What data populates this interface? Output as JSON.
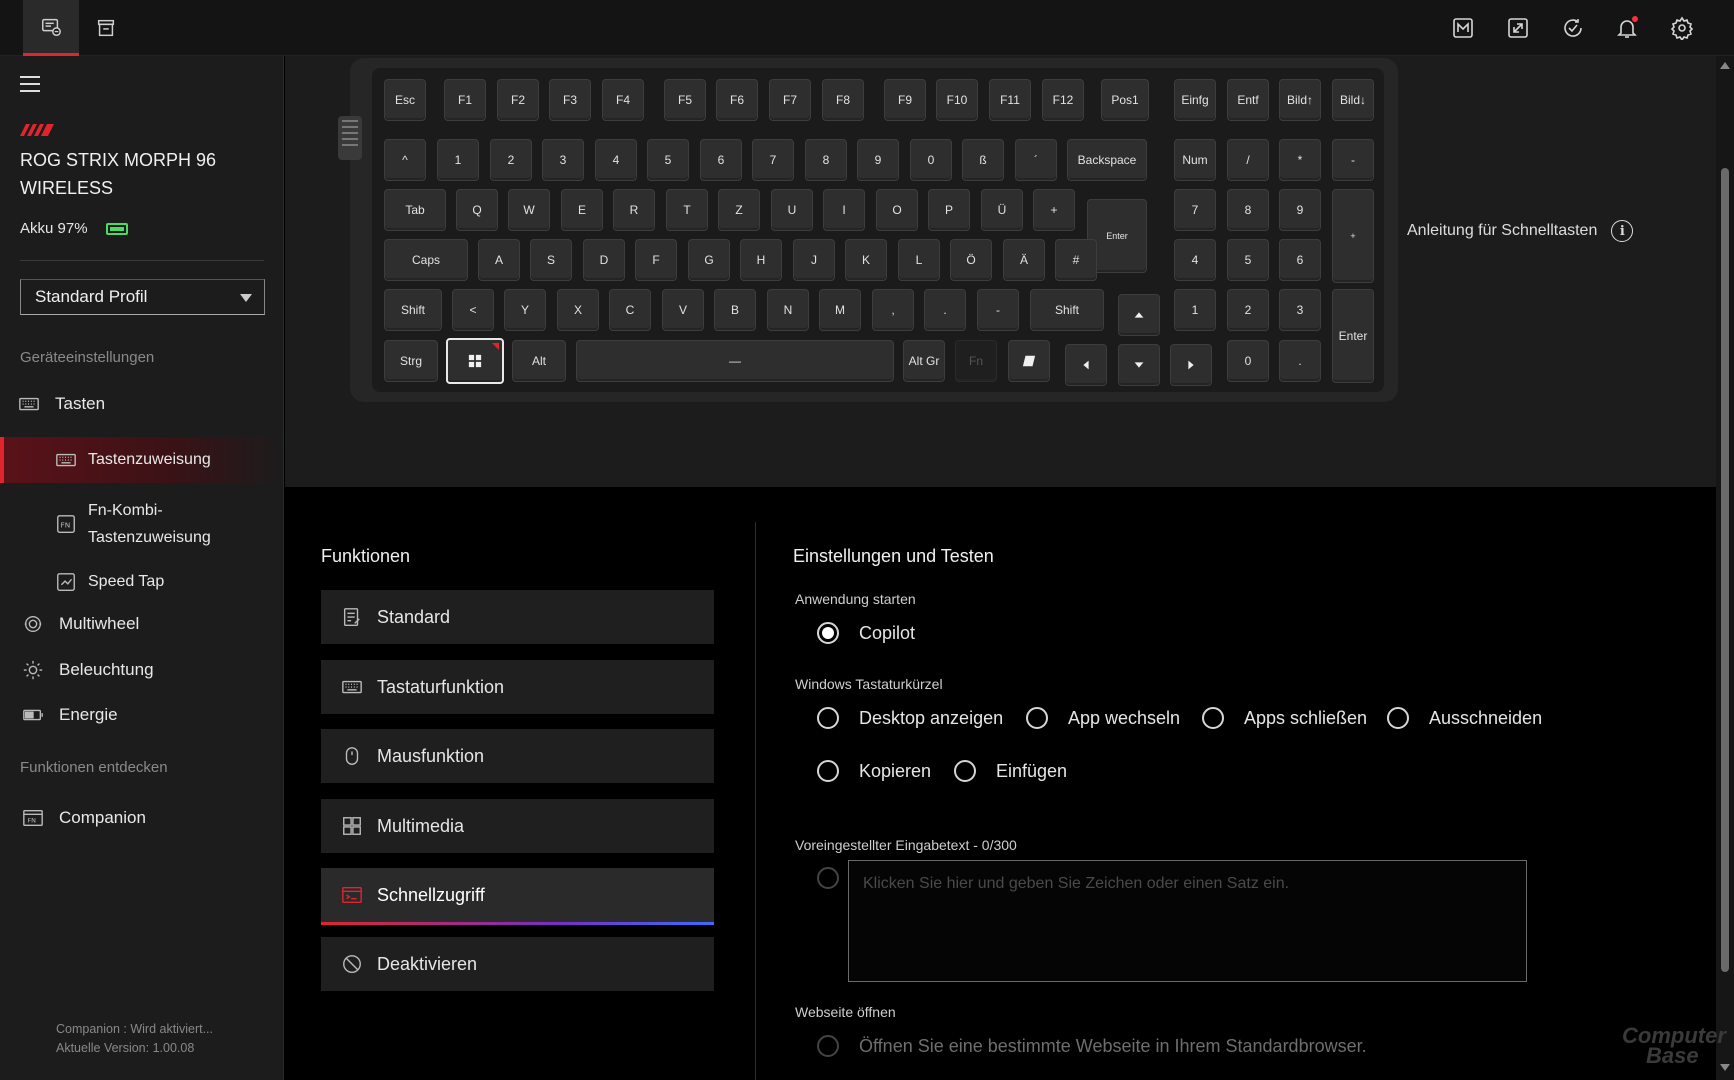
{
  "topbar": {
    "left_icons": [
      "device-icon",
      "store-icon"
    ],
    "right_icons": [
      "macro-icon",
      "resize-icon",
      "update-check-icon",
      "bell-icon",
      "gear-icon"
    ]
  },
  "sidebar": {
    "device_name": "ROG STRIX MORPH 96 WIRELESS",
    "battery_label": "Akku 97%",
    "profile": "Standard Profil",
    "section_device": "Geräteeinstellungen",
    "section_discover": "Funktionen entdecken",
    "items": {
      "tasten": "Tasten",
      "tastenzuweisung": "Tastenzuweisung",
      "fn_kombi_1": "Fn-Kombi-",
      "fn_kombi_2": "Tastenzuweisung",
      "speed_tap": "Speed Tap",
      "multiwheel": "Multiwheel",
      "beleuchtung": "Beleuchtung",
      "energie": "Energie",
      "companion": "Companion"
    },
    "footer_status": "Companion : Wird aktiviert...",
    "footer_version": "Aktuelle Version: 1.00.08"
  },
  "keyboard": {
    "keys": {
      "esc": "Esc",
      "f1": "F1",
      "f2": "F2",
      "f3": "F3",
      "f4": "F4",
      "f5": "F5",
      "f6": "F6",
      "f7": "F7",
      "f8": "F8",
      "f9": "F9",
      "f10": "F10",
      "f11": "F11",
      "f12": "F12",
      "pos1": "Pos1",
      "einfg": "Einfg",
      "entf": "Entf",
      "bild_up": "Bild↑",
      "bild_down": "Bild↓",
      "caret": "^",
      "n1": "1",
      "n2": "2",
      "n3": "3",
      "n4": "4",
      "n5": "5",
      "n6": "6",
      "n7": "7",
      "n8": "8",
      "n9": "9",
      "n0": "0",
      "sz": "ß",
      "acute": "´",
      "backspace": "Backspace",
      "num": "Num",
      "np_div": "/",
      "np_mul": "*",
      "np_minus": "-",
      "tab": "Tab",
      "q": "Q",
      "w": "W",
      "e": "E",
      "r": "R",
      "t": "T",
      "z": "Z",
      "u": "U",
      "i": "I",
      "o": "O",
      "p": "P",
      "ue": "Ü",
      "plus": "+",
      "enter": "Enter",
      "np7": "7",
      "np8": "8",
      "np9": "9",
      "np_plus": "+",
      "caps": "Caps",
      "a": "A",
      "s": "S",
      "d": "D",
      "f": "F",
      "g": "G",
      "h": "H",
      "j": "J",
      "k": "K",
      "l": "L",
      "oe": "Ö",
      "ae": "Ä",
      "hash": "#",
      "np4": "4",
      "np5": "5",
      "np6": "6",
      "lshift": "Shift",
      "lt": "<",
      "y": "Y",
      "x": "X",
      "c": "C",
      "v": "V",
      "b": "B",
      "n": "N",
      "m": "M",
      "comma": ",",
      "period": ".",
      "dash": "-",
      "rshift": "Shift",
      "np1": "1",
      "np2": "2",
      "np3": "3",
      "np_enter": "Enter",
      "strg": "Strg",
      "alt": "Alt",
      "space": "—",
      "altgr": "Alt Gr",
      "fn": "Fn",
      "np0": "0",
      "np_dot": "."
    },
    "shortcut_guide": "Anleitung für Schnelltasten"
  },
  "functions": {
    "title": "Funktionen",
    "items": {
      "standard": "Standard",
      "tastatur": "Tastaturfunktion",
      "maus": "Mausfunktion",
      "multimedia": "Multimedia",
      "schnellzugriff": "Schnellzugriff",
      "deaktivieren": "Deaktivieren"
    }
  },
  "settings": {
    "title": "Einstellungen und Testen",
    "launch_label": "Anwendung starten",
    "copilot": "Copilot",
    "shortcuts_label": "Windows Tastaturkürzel",
    "desktop": "Desktop anzeigen",
    "app_switch": "App wechseln",
    "apps_close": "Apps schließen",
    "cut": "Ausschneiden",
    "copy": "Kopieren",
    "paste": "Einfügen",
    "preset_label": "Voreingestellter Eingabetext - 0/300",
    "preset_placeholder": "Klicken Sie hier und geben Sie Zeichen oder einen Satz ein.",
    "web_label": "Webseite öffnen",
    "web_option": "Öffnen Sie eine bestimmte Webseite in Ihrem Standardbrowser."
  },
  "watermark": {
    "line1": "Computer",
    "line2": "Base"
  },
  "colors": {
    "accent": "#e0252f",
    "battery": "#4cd964"
  }
}
